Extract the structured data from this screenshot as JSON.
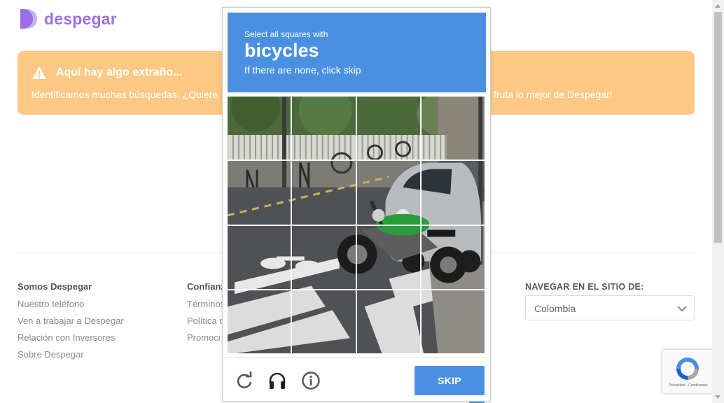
{
  "brand": {
    "name": "despegar",
    "color": "#9b6ee8"
  },
  "alert": {
    "title": "Aquí hay algo extraño...",
    "text_left": "Identificamos muchas búsquedas. ¿Quiere",
    "text_right": "fruta lo mejor de Despegar!",
    "icon": "warning-icon",
    "color": "#fcc884"
  },
  "footer": {
    "col1": {
      "head": "Somos Despegar",
      "links": [
        "Nuestro teléfono",
        "Ven a trabajar a Despegar",
        "Relación con Inversores",
        "Sobre Despegar"
      ]
    },
    "col2": {
      "head": "Confianz",
      "links": [
        "Términos",
        "Política c",
        "Promoci"
      ]
    },
    "nav": {
      "head": "NAVEGAR EN EL SITIO DE:",
      "selected": "Colombia"
    }
  },
  "captcha": {
    "instruction_small": "Select all squares with",
    "target": "bicycles",
    "instruction_sub": "If there are none, click skip",
    "skip_label": "SKIP",
    "accent": "#4a90e2",
    "controls": [
      "reload-icon",
      "audio-icon",
      "info-icon"
    ]
  },
  "recaptcha_badge": {
    "terms": "Privacidad - Condiciones"
  }
}
